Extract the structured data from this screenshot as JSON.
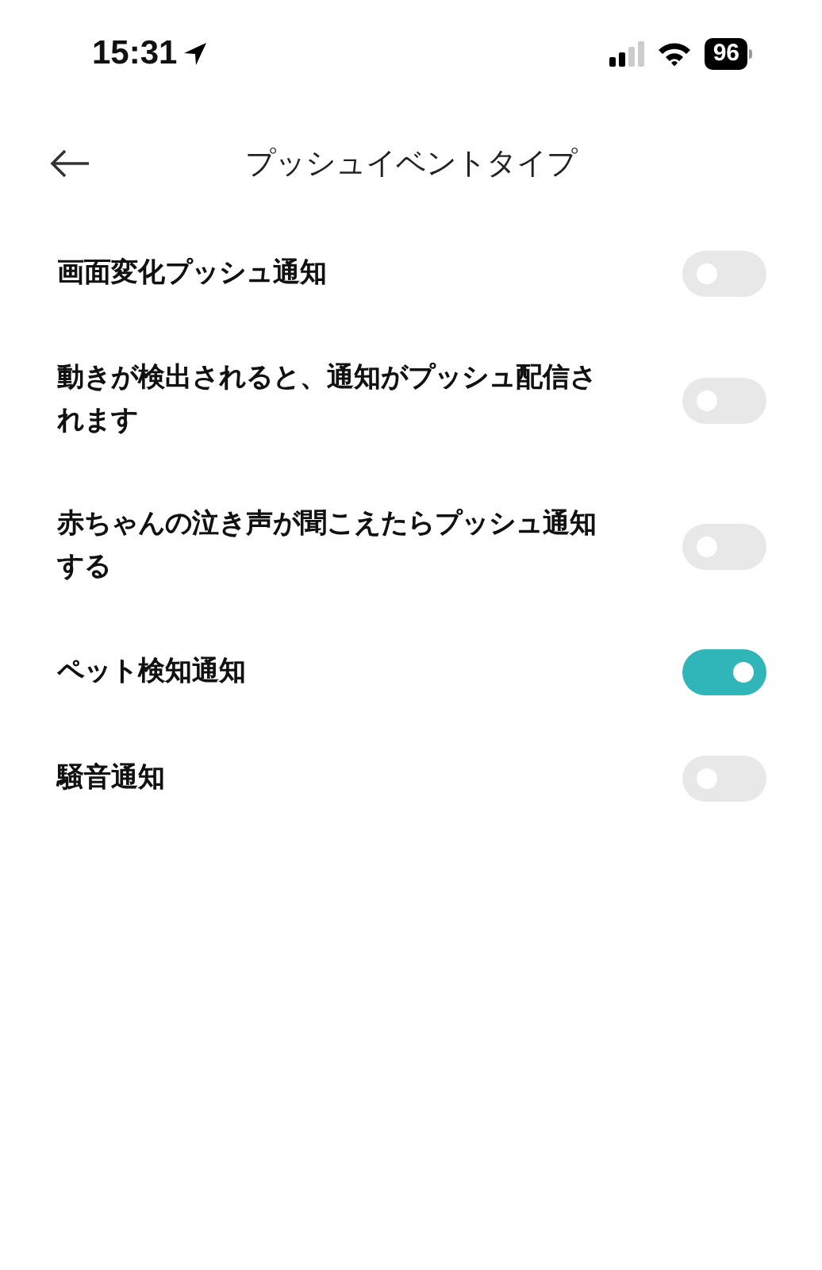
{
  "status_bar": {
    "time": "15:31",
    "battery": "96"
  },
  "header": {
    "title": "プッシュイベントタイプ"
  },
  "settings": [
    {
      "label": "画面変化プッシュ通知",
      "on": false
    },
    {
      "label": "動きが検出されると、通知がプッシュ配信されます",
      "on": false
    },
    {
      "label": "赤ちゃんの泣き声が聞こえたらプッシュ通知する",
      "on": false
    },
    {
      "label": "ペット検知通知",
      "on": true
    },
    {
      "label": "騒音通知",
      "on": false
    }
  ]
}
